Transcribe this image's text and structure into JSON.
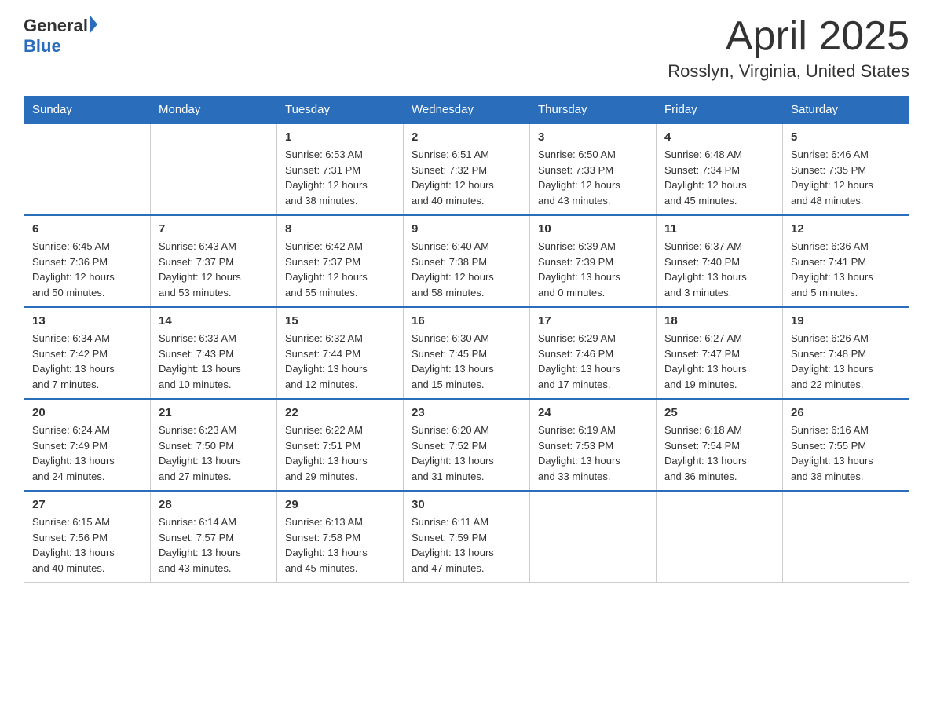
{
  "header": {
    "logo_general": "General",
    "logo_blue": "Blue",
    "month_title": "April 2025",
    "location": "Rosslyn, Virginia, United States"
  },
  "weekdays": [
    "Sunday",
    "Monday",
    "Tuesday",
    "Wednesday",
    "Thursday",
    "Friday",
    "Saturday"
  ],
  "weeks": [
    [
      {
        "day": "",
        "info": ""
      },
      {
        "day": "",
        "info": ""
      },
      {
        "day": "1",
        "info": "Sunrise: 6:53 AM\nSunset: 7:31 PM\nDaylight: 12 hours\nand 38 minutes."
      },
      {
        "day": "2",
        "info": "Sunrise: 6:51 AM\nSunset: 7:32 PM\nDaylight: 12 hours\nand 40 minutes."
      },
      {
        "day": "3",
        "info": "Sunrise: 6:50 AM\nSunset: 7:33 PM\nDaylight: 12 hours\nand 43 minutes."
      },
      {
        "day": "4",
        "info": "Sunrise: 6:48 AM\nSunset: 7:34 PM\nDaylight: 12 hours\nand 45 minutes."
      },
      {
        "day": "5",
        "info": "Sunrise: 6:46 AM\nSunset: 7:35 PM\nDaylight: 12 hours\nand 48 minutes."
      }
    ],
    [
      {
        "day": "6",
        "info": "Sunrise: 6:45 AM\nSunset: 7:36 PM\nDaylight: 12 hours\nand 50 minutes."
      },
      {
        "day": "7",
        "info": "Sunrise: 6:43 AM\nSunset: 7:37 PM\nDaylight: 12 hours\nand 53 minutes."
      },
      {
        "day": "8",
        "info": "Sunrise: 6:42 AM\nSunset: 7:37 PM\nDaylight: 12 hours\nand 55 minutes."
      },
      {
        "day": "9",
        "info": "Sunrise: 6:40 AM\nSunset: 7:38 PM\nDaylight: 12 hours\nand 58 minutes."
      },
      {
        "day": "10",
        "info": "Sunrise: 6:39 AM\nSunset: 7:39 PM\nDaylight: 13 hours\nand 0 minutes."
      },
      {
        "day": "11",
        "info": "Sunrise: 6:37 AM\nSunset: 7:40 PM\nDaylight: 13 hours\nand 3 minutes."
      },
      {
        "day": "12",
        "info": "Sunrise: 6:36 AM\nSunset: 7:41 PM\nDaylight: 13 hours\nand 5 minutes."
      }
    ],
    [
      {
        "day": "13",
        "info": "Sunrise: 6:34 AM\nSunset: 7:42 PM\nDaylight: 13 hours\nand 7 minutes."
      },
      {
        "day": "14",
        "info": "Sunrise: 6:33 AM\nSunset: 7:43 PM\nDaylight: 13 hours\nand 10 minutes."
      },
      {
        "day": "15",
        "info": "Sunrise: 6:32 AM\nSunset: 7:44 PM\nDaylight: 13 hours\nand 12 minutes."
      },
      {
        "day": "16",
        "info": "Sunrise: 6:30 AM\nSunset: 7:45 PM\nDaylight: 13 hours\nand 15 minutes."
      },
      {
        "day": "17",
        "info": "Sunrise: 6:29 AM\nSunset: 7:46 PM\nDaylight: 13 hours\nand 17 minutes."
      },
      {
        "day": "18",
        "info": "Sunrise: 6:27 AM\nSunset: 7:47 PM\nDaylight: 13 hours\nand 19 minutes."
      },
      {
        "day": "19",
        "info": "Sunrise: 6:26 AM\nSunset: 7:48 PM\nDaylight: 13 hours\nand 22 minutes."
      }
    ],
    [
      {
        "day": "20",
        "info": "Sunrise: 6:24 AM\nSunset: 7:49 PM\nDaylight: 13 hours\nand 24 minutes."
      },
      {
        "day": "21",
        "info": "Sunrise: 6:23 AM\nSunset: 7:50 PM\nDaylight: 13 hours\nand 27 minutes."
      },
      {
        "day": "22",
        "info": "Sunrise: 6:22 AM\nSunset: 7:51 PM\nDaylight: 13 hours\nand 29 minutes."
      },
      {
        "day": "23",
        "info": "Sunrise: 6:20 AM\nSunset: 7:52 PM\nDaylight: 13 hours\nand 31 minutes."
      },
      {
        "day": "24",
        "info": "Sunrise: 6:19 AM\nSunset: 7:53 PM\nDaylight: 13 hours\nand 33 minutes."
      },
      {
        "day": "25",
        "info": "Sunrise: 6:18 AM\nSunset: 7:54 PM\nDaylight: 13 hours\nand 36 minutes."
      },
      {
        "day": "26",
        "info": "Sunrise: 6:16 AM\nSunset: 7:55 PM\nDaylight: 13 hours\nand 38 minutes."
      }
    ],
    [
      {
        "day": "27",
        "info": "Sunrise: 6:15 AM\nSunset: 7:56 PM\nDaylight: 13 hours\nand 40 minutes."
      },
      {
        "day": "28",
        "info": "Sunrise: 6:14 AM\nSunset: 7:57 PM\nDaylight: 13 hours\nand 43 minutes."
      },
      {
        "day": "29",
        "info": "Sunrise: 6:13 AM\nSunset: 7:58 PM\nDaylight: 13 hours\nand 45 minutes."
      },
      {
        "day": "30",
        "info": "Sunrise: 6:11 AM\nSunset: 7:59 PM\nDaylight: 13 hours\nand 47 minutes."
      },
      {
        "day": "",
        "info": ""
      },
      {
        "day": "",
        "info": ""
      },
      {
        "day": "",
        "info": ""
      }
    ]
  ]
}
